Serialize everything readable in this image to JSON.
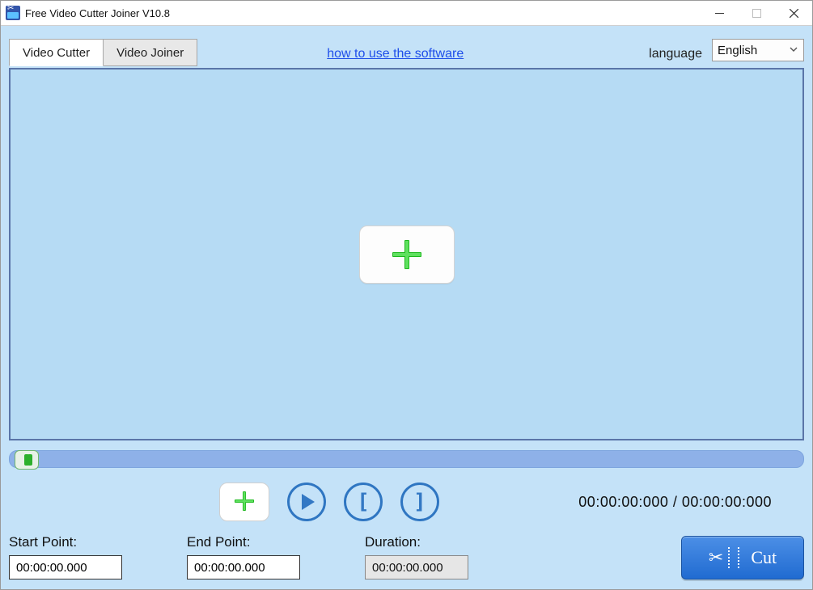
{
  "window": {
    "title": "Free Video Cutter Joiner V10.8"
  },
  "tabs": {
    "cutter": "Video Cutter",
    "joiner": "Video Joiner"
  },
  "links": {
    "howto": "how to use the software"
  },
  "language": {
    "label": "language",
    "selected": "English"
  },
  "timecode": {
    "display": "00:00:00:000 / 00:00:00:000"
  },
  "fields": {
    "start_label": "Start Point:",
    "start_value": "00:00:00.000",
    "end_label": "End Point:",
    "end_value": "00:00:00.000",
    "duration_label": "Duration:",
    "duration_value": "00:00:00.000"
  },
  "buttons": {
    "cut": "Cut"
  }
}
